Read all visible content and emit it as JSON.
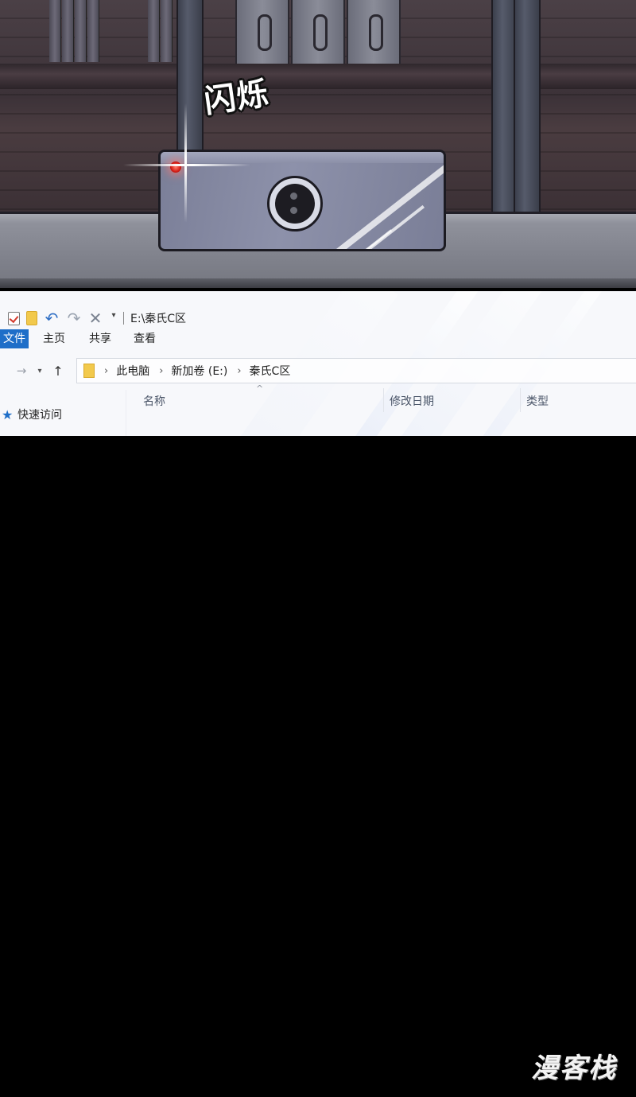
{
  "scene": {
    "sfx": "闪烁"
  },
  "explorer": {
    "title": "E:\\秦氏C区",
    "quick_access_icons": [
      "properties-icon",
      "new-folder-icon",
      "undo-icon",
      "redo-icon",
      "delete-icon",
      "customize-dropdown-icon"
    ],
    "ribbon_tabs": {
      "file": "文件",
      "home": "主页",
      "share": "共享",
      "view": "查看"
    },
    "breadcrumb": [
      "此电脑",
      "新加卷 (E:)",
      "秦氏C区"
    ],
    "columns": {
      "name": "名称",
      "date_modified": "修改日期",
      "type": "类型"
    },
    "sidebar": {
      "quick_access": "快速访问"
    }
  },
  "watermark": {
    "text": "漫客栈"
  },
  "colors": {
    "file_tab": "#1e6ec8",
    "led": "#d21b14",
    "background": "#000000"
  }
}
